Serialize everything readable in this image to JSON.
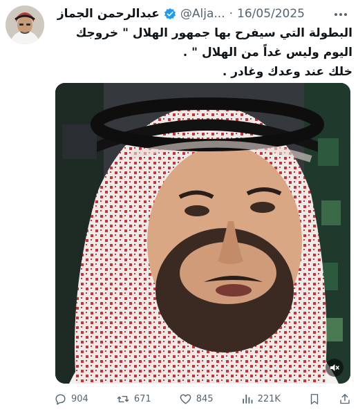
{
  "author": {
    "name": "عبدالرحمن الجماز",
    "handle": "@Alja...",
    "separator": "·",
    "date": "16/05/2025",
    "verified_color": "#1d9bf0"
  },
  "tweet": {
    "lines": [
      "البطولة التي سيفرح بها جمهور الهلال \" خروجك",
      "اليوم وليس غداً من الهلال \" .",
      "خلك عند وعدك وغادر ."
    ]
  },
  "media": {
    "type": "video",
    "mute_icon": "speaker-muted-icon"
  },
  "actions": {
    "replies": "904",
    "reposts": "671",
    "likes": "845",
    "views": "221K"
  },
  "colors": {
    "secondary_text": "#536471",
    "primary_text": "#0f1419",
    "accent": "#1d9bf0"
  }
}
